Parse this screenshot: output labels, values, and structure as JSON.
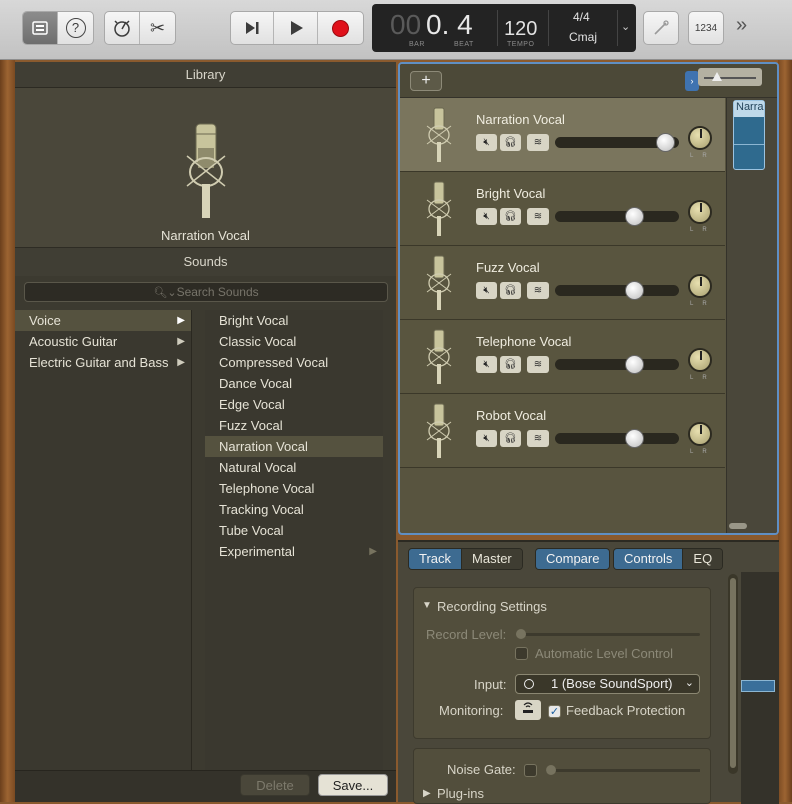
{
  "toolbar": {
    "library_icon": "library-icon",
    "help_label": "?",
    "metronome_icon": "metronome-icon",
    "scissors_icon": "scissors-icon",
    "goto_start_icon": "goto-start-icon",
    "play_icon": "play-icon",
    "record_icon": "record-icon",
    "lcd": {
      "bar_prefix": "00",
      "bar_value": "0. 4",
      "bar_label": "BAR",
      "beat_label": "BEAT",
      "tempo": "120",
      "tempo_label": "TEMPO",
      "time_signature": "4/4",
      "key": "Cmaj"
    },
    "tuner_icon": "tuner-icon",
    "count_in_label": "1234",
    "more_label": "»",
    "colors": {
      "record": "#e0111b",
      "lcd_bg": "#232323"
    }
  },
  "library": {
    "title": "Library",
    "patch_name": "Narration Vocal",
    "sounds_header": "Sounds",
    "search_placeholder": "Search Sounds",
    "categories": [
      {
        "label": "Voice",
        "selected": true
      },
      {
        "label": "Acoustic Guitar",
        "selected": false
      },
      {
        "label": "Electric Guitar and Bass",
        "selected": false
      }
    ],
    "presets": [
      {
        "label": "Bright Vocal"
      },
      {
        "label": "Classic Vocal"
      },
      {
        "label": "Compressed Vocal"
      },
      {
        "label": "Dance Vocal"
      },
      {
        "label": "Edge Vocal"
      },
      {
        "label": "Fuzz Vocal"
      },
      {
        "label": "Narration Vocal",
        "selected": true
      },
      {
        "label": "Natural Vocal"
      },
      {
        "label": "Telephone Vocal"
      },
      {
        "label": "Tracking Vocal"
      },
      {
        "label": "Tube Vocal"
      },
      {
        "label": "Experimental",
        "submenu": true
      }
    ],
    "delete_label": "Delete",
    "save_label": "Save..."
  },
  "tracks": {
    "add_label": "+",
    "region_label": "Narra",
    "list": [
      {
        "name": "Narration Vocal",
        "volume": 0.95,
        "selected": true
      },
      {
        "name": "Bright Vocal",
        "volume": 0.7
      },
      {
        "name": "Fuzz Vocal",
        "volume": 0.7
      },
      {
        "name": "Telephone Vocal",
        "volume": 0.7
      },
      {
        "name": "Robot Vocal",
        "volume": 0.7
      }
    ],
    "pan_l": "L",
    "pan_r": "R"
  },
  "smart_controls": {
    "tabs_left": [
      "Track",
      "Master"
    ],
    "compare_label": "Compare",
    "tabs_right": [
      "Controls",
      "EQ"
    ],
    "recording_settings_title": "Recording Settings",
    "record_level_label": "Record Level:",
    "auto_level_label": "Automatic Level Control",
    "input_label": "Input:",
    "input_value": "1  (Bose SoundSport)",
    "monitoring_label": "Monitoring:",
    "feedback_label": "Feedback Protection",
    "noise_gate_label": "Noise Gate:",
    "plugins_label": "Plug-ins"
  }
}
